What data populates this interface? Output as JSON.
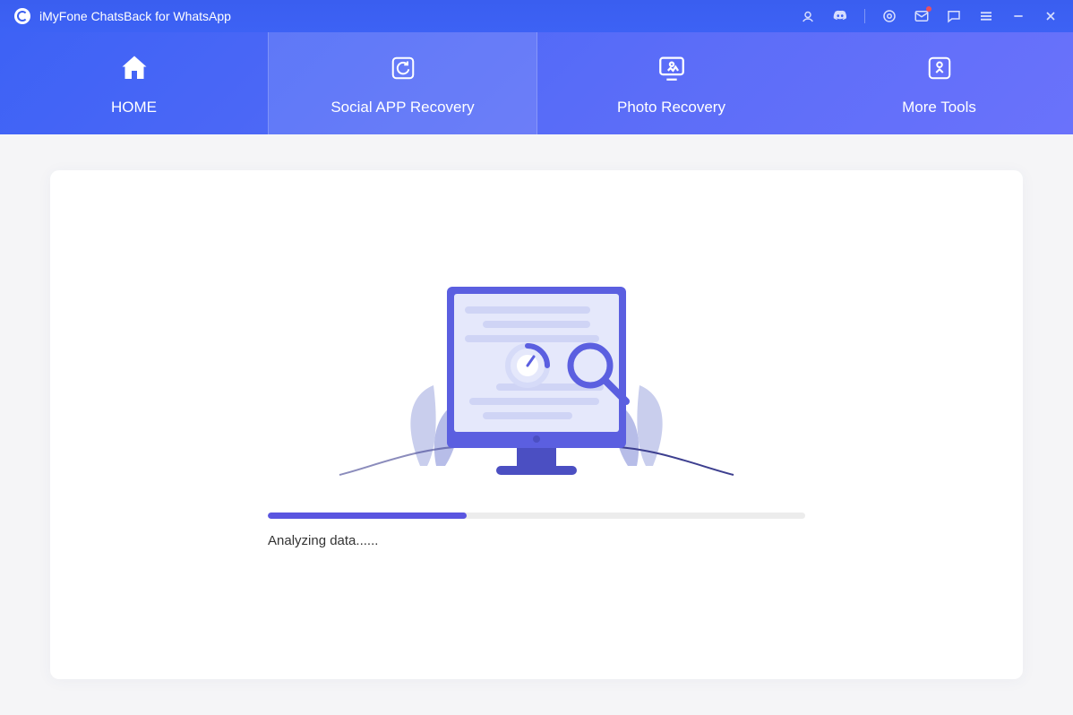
{
  "app": {
    "title": "iMyFone ChatsBack for WhatsApp"
  },
  "nav": {
    "tabs": [
      {
        "label": "HOME"
      },
      {
        "label": "Social APP Recovery"
      },
      {
        "label": "Photo Recovery"
      },
      {
        "label": "More Tools"
      }
    ],
    "active_index": 1
  },
  "progress": {
    "percent": 37,
    "status": "Analyzing data......"
  },
  "colors": {
    "accent": "#5a55e0",
    "gradient_start": "#3d62f5",
    "gradient_end": "#6a72fb"
  }
}
